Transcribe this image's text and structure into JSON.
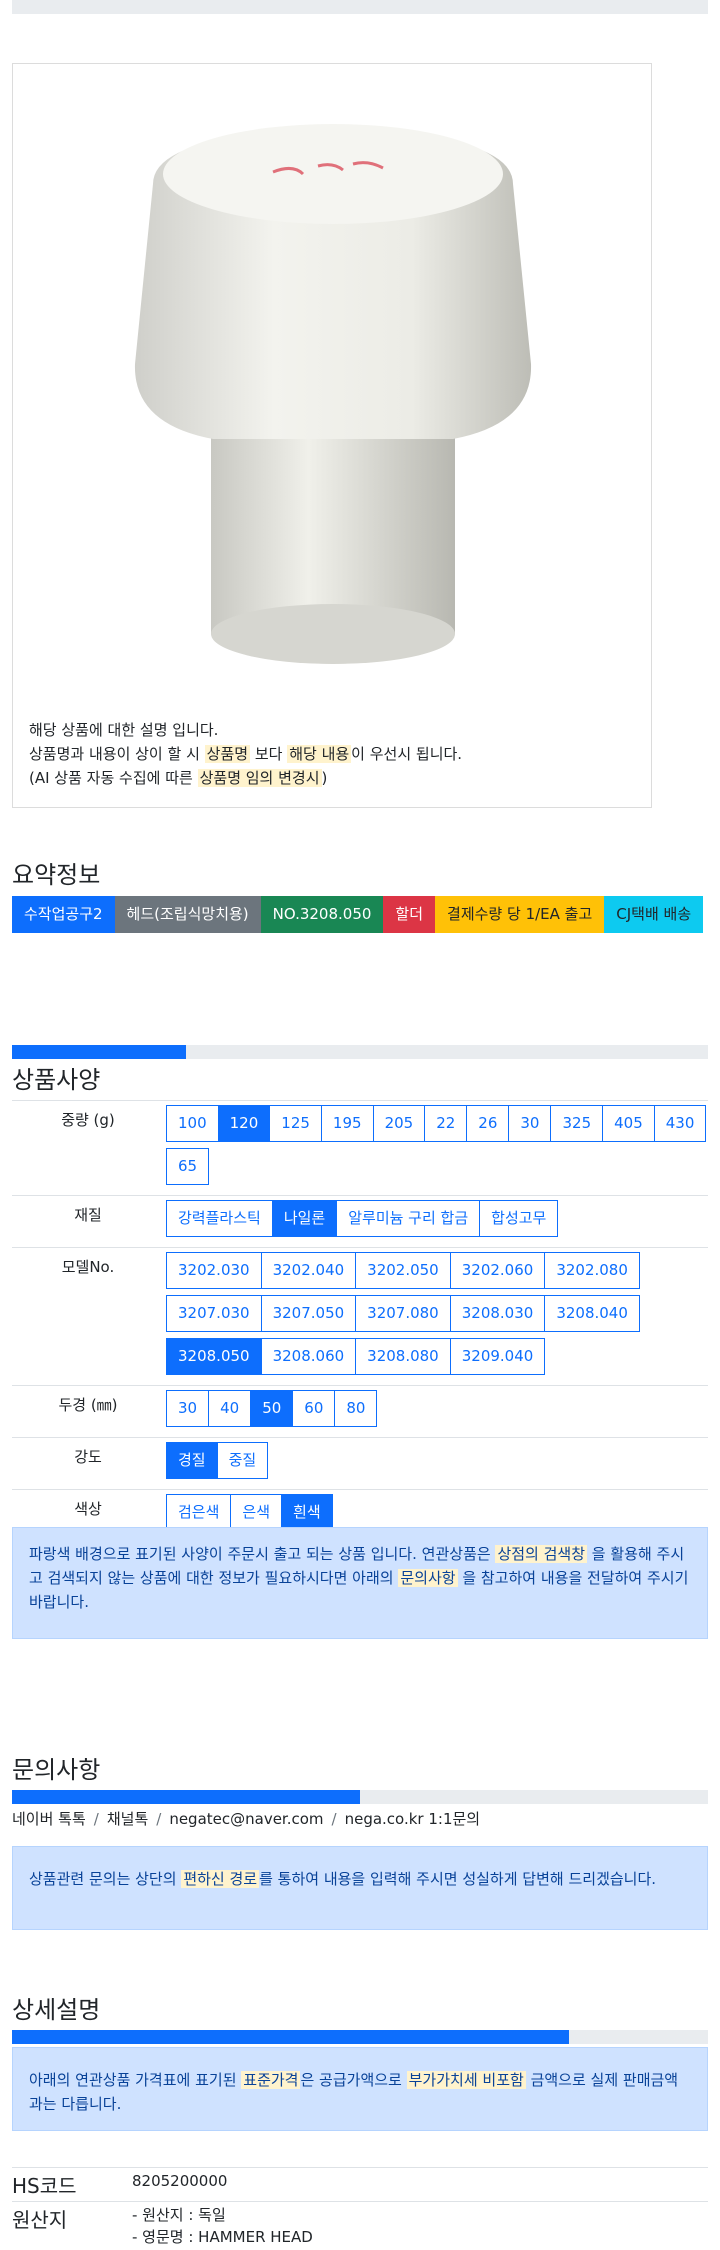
{
  "product_description": {
    "line1": "해당 상품에 대한 설명 입니다.",
    "line2_a": "상품명과 내용이 상이 할 시 ",
    "line2_hl1": "상품명",
    "line2_b": " 보다 ",
    "line2_hl2": "해당 내용",
    "line2_c": "이 우선시 됩니다.",
    "line3_a": "(AI 상품 자동 수집에 따른 ",
    "line3_hl": "상품명 임의 변경시",
    "line3_b": ")"
  },
  "summary": {
    "title": "요약정보",
    "badges": [
      {
        "label": "수작업공구2",
        "color": "blue"
      },
      {
        "label": "헤드(조립식망치용)",
        "color": "gray"
      },
      {
        "label": "NO.3208.050",
        "color": "green"
      },
      {
        "label": "할더",
        "color": "red"
      },
      {
        "label": "결제수량 당 1/EA 출고",
        "color": "yellow"
      },
      {
        "label": "CJ택배 배송",
        "color": "cyan"
      }
    ]
  },
  "spec": {
    "title": "상품사양",
    "progress": 0.25,
    "rows": [
      {
        "label": "중량 (g)",
        "options": [
          "100",
          "120",
          "125",
          "195",
          "205",
          "22",
          "26",
          "30",
          "325",
          "405",
          "430",
          "65"
        ],
        "selected": "120"
      },
      {
        "label": "재질",
        "options": [
          "강력플라스틱",
          "나일론",
          "알루미늄 구리 합금",
          "합성고무"
        ],
        "selected": "나일론"
      },
      {
        "label": "모델No.",
        "options": [
          "3202.030",
          "3202.040",
          "3202.050",
          "3202.060",
          "3202.080",
          "3207.030",
          "3207.050",
          "3207.080",
          "3208.030",
          "3208.040",
          "3208.050",
          "3208.060",
          "3208.080",
          "3209.040"
        ],
        "selected": "3208.050"
      },
      {
        "label": "두경 (㎜)",
        "options": [
          "30",
          "40",
          "50",
          "60",
          "80"
        ],
        "selected": "50"
      },
      {
        "label": "강도",
        "options": [
          "경질",
          "중질"
        ],
        "selected": "경질"
      },
      {
        "label": "색상",
        "options": [
          "검은색",
          "은색",
          "흰색"
        ],
        "selected": "흰색"
      }
    ],
    "notice_a": "파랑색 배경으로 표기된 사양이 주문시 출고 되는 상품 입니다. 연관상품은 ",
    "notice_hl1": "상점의 검색창",
    "notice_b": " 을 활용해 주시고 검색되지 않는 상품에 대한 정보가 필요하시다면 아래의 ",
    "notice_hl2": "문의사항",
    "notice_c": " 을 참고하여 내용을 전달하여 주시기 바랍니다."
  },
  "inquiry": {
    "title": "문의사항",
    "progress": 0.5,
    "links": [
      "네이버 톡톡",
      "채널톡",
      "negatec@naver.com",
      "nega.co.kr 1:1문의"
    ],
    "notice_a": "상품관련 문의는 상단의 ",
    "notice_hl": "편하신 경로",
    "notice_b": "를 통하여 내용을 입력해 주시면 성실하게 답변해 드리겠습니다."
  },
  "detail": {
    "title": "상세설명",
    "progress": 0.8,
    "notice_a": "아래의 연관상품 가격표에 표기된 ",
    "notice_hl1": "표준가격",
    "notice_b": "은 공급가액으로 ",
    "notice_hl2": "부가가치세 비포함",
    "notice_c": " 금액으로 실제 판매금액과는 다릅니다."
  },
  "info": {
    "hs_key": "HS코드",
    "hs_value": "8205200000",
    "origin_key": "원산지",
    "origin_line1": "- 원산지 : 독일",
    "origin_line2": "- 영문명 : HAMMER HEAD"
  },
  "colors": {
    "accent": "#0d6efd",
    "highlight": "#fff3cd",
    "alert_bg": "#cfe2ff"
  }
}
